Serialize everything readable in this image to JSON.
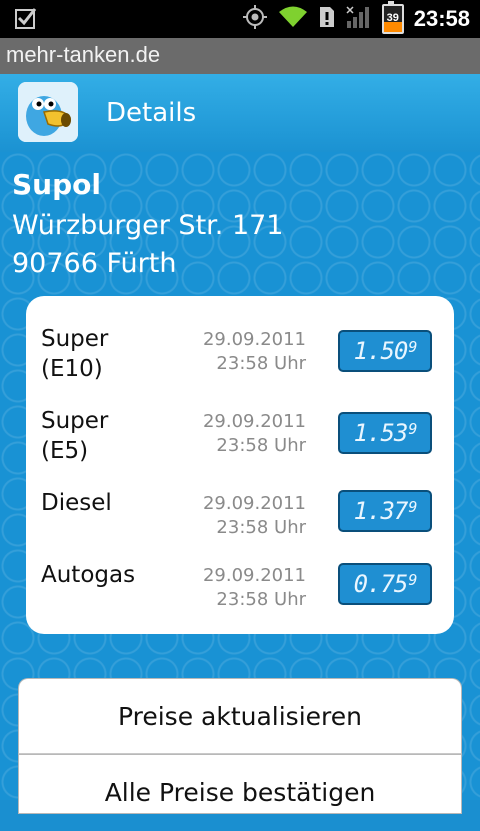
{
  "status_bar": {
    "time": "23:58",
    "battery": "39",
    "icons": [
      "checkbox-icon",
      "gps-icon",
      "wifi-icon",
      "alert-icon",
      "signal-icon",
      "battery-icon"
    ]
  },
  "browser": {
    "url": "mehr-tanken.de"
  },
  "header": {
    "title": "Details",
    "logo": "bird-logo"
  },
  "station": {
    "name": "Supol",
    "street": "Würzburger Str. 171",
    "city": "90766 Fürth"
  },
  "prices": [
    {
      "fuel_line1": "Super",
      "fuel_line2": "(E10)",
      "date": "29.09.2011",
      "time": "23:58 Uhr",
      "price_main": "1.50",
      "price_tenth": "9"
    },
    {
      "fuel_line1": "Super",
      "fuel_line2": "(E5)",
      "date": "29.09.2011",
      "time": "23:58 Uhr",
      "price_main": "1.53",
      "price_tenth": "9"
    },
    {
      "fuel_line1": "Diesel",
      "fuel_line2": "",
      "date": "29.09.2011",
      "time": "23:58 Uhr",
      "price_main": "1.37",
      "price_tenth": "9"
    },
    {
      "fuel_line1": "Autogas",
      "fuel_line2": "",
      "date": "29.09.2011",
      "time": "23:58 Uhr",
      "price_main": "0.75",
      "price_tenth": "9"
    }
  ],
  "buttons": {
    "update": "Preise aktualisieren",
    "confirm": "Alle Preise bestätigen"
  },
  "colors": {
    "background": "#1992d4",
    "header": "#33aee6",
    "price_box": "#1f8fd2"
  }
}
